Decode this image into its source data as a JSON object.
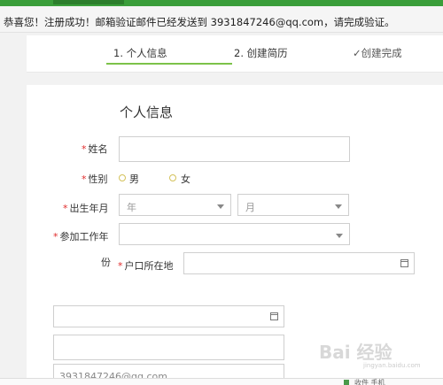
{
  "notice": {
    "message": "恭喜您！注册成功！邮箱验证邮件已经发送到 3931847246@qq.com，请完成验证。"
  },
  "steps": [
    {
      "label": "1. 个人信息",
      "active": true
    },
    {
      "label": "2. 创建简历",
      "active": false
    },
    {
      "label": "✓创建完成",
      "active": false
    }
  ],
  "form": {
    "title": "个人信息",
    "name_label": "姓名",
    "gender_label": "性别",
    "gender_options": [
      "男",
      "女"
    ],
    "birth_label": "出生年月",
    "birth_year_placeholder": "年",
    "birth_month_placeholder": "月",
    "work_label_line1": "参加工作年",
    "work_label_line2": "份",
    "hukou_label": "户口所在地",
    "email_value": "3931847246@qq.com"
  },
  "watermark": {
    "text": "Bai 经验",
    "sub": "jingyan.baidu.com"
  },
  "bottombar": {
    "text": "收件 手机"
  },
  "colors": {
    "accent_green": "#7cc249",
    "required_red": "#e02b2b",
    "topbar_green": "#3a9e3a"
  }
}
